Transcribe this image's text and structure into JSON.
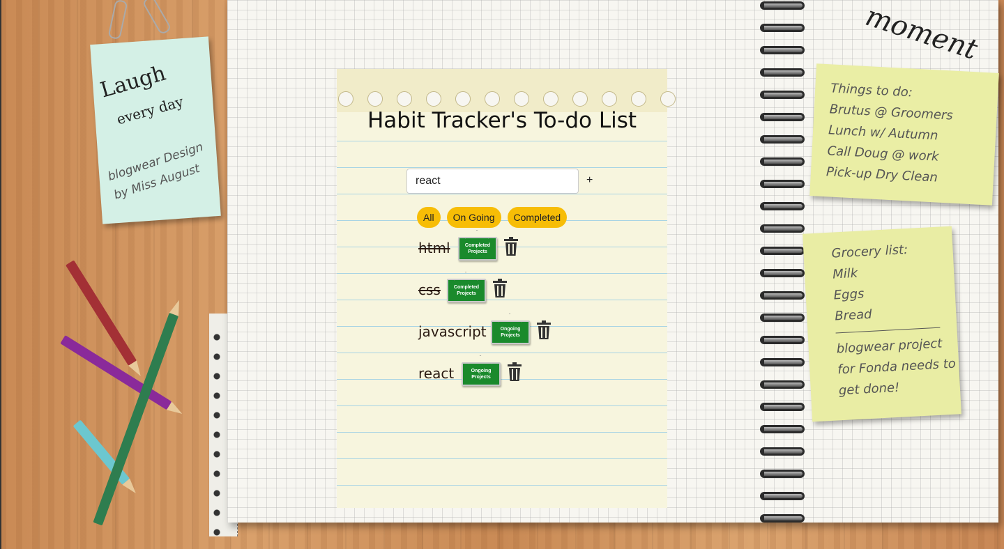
{
  "background": {
    "sticky_blue": {
      "big": "Laugh",
      "small": "every day",
      "credit_1": "blogwear Design",
      "credit_2": "by Miss August"
    },
    "moment_text": "moment",
    "sticky_yellow1": {
      "lines": [
        "Things to do:",
        "Brutus @ Groomers",
        "Lunch w/ Autumn",
        "Call Doug @ work",
        "Pick-up Dry Clean"
      ]
    },
    "sticky_yellow2": {
      "lines": [
        "Grocery list:",
        "Milk",
        "Eggs",
        "Bread"
      ],
      "footer": [
        "blogwear project",
        "for Fonda needs to",
        "get done!"
      ]
    }
  },
  "app": {
    "title": "Habit Tracker's To-do List",
    "input": {
      "value": "react",
      "add_label": "+"
    },
    "filters": [
      "All",
      "On Going",
      "Completed"
    ],
    "todos": [
      {
        "text": "html",
        "status": "Completed Projects",
        "completed": true
      },
      {
        "text": "css",
        "status": "Completed Projects",
        "completed": true
      },
      {
        "text": "javascript",
        "status": "Ongoing Projects",
        "completed": false
      },
      {
        "text": "react",
        "status": "Ongoing Projects",
        "completed": false
      }
    ]
  },
  "colors": {
    "filter_button": "#f7bd06",
    "status_sign": "#1a8a2c",
    "accent_text": "#2a1a12"
  }
}
